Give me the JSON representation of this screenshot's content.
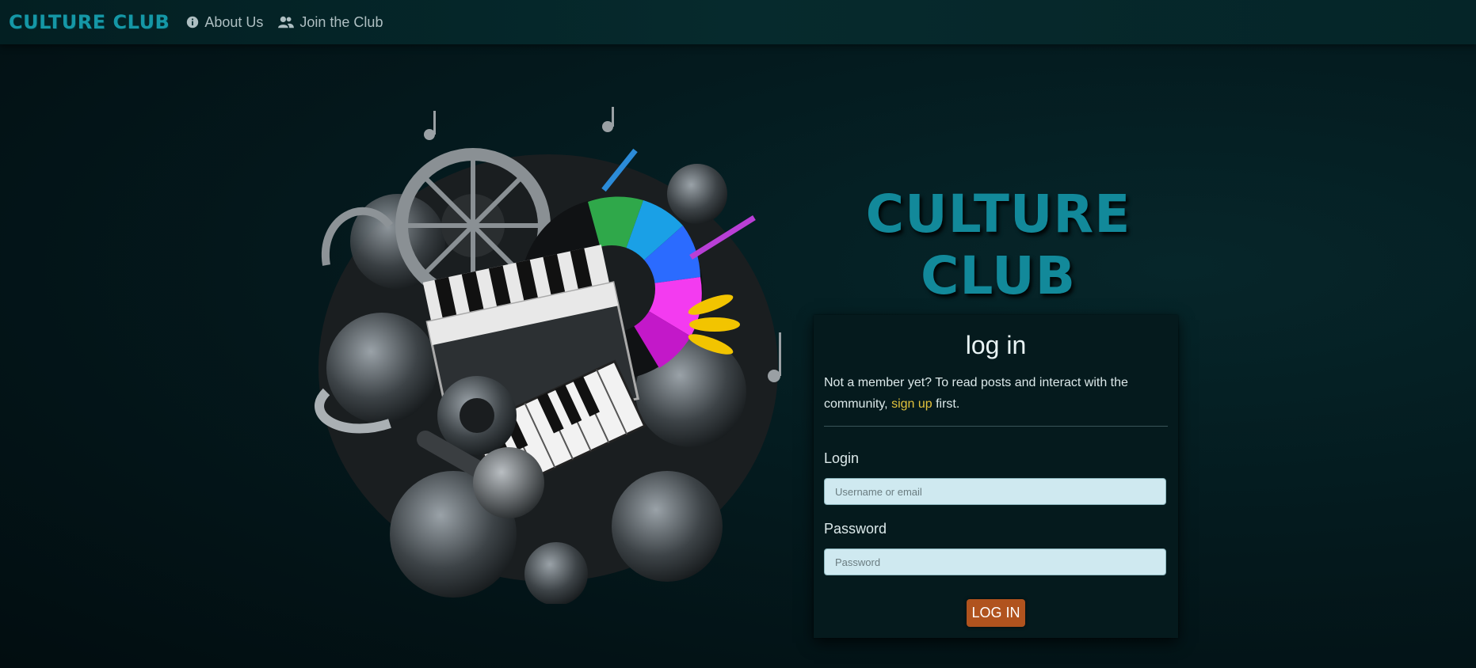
{
  "navbar": {
    "brand": "CULTURE CLUB",
    "links": [
      {
        "label": "About Us",
        "icon": "info-circle-icon"
      },
      {
        "label": "Join the Club",
        "icon": "users-icon"
      }
    ]
  },
  "hero": {
    "image": "culture-collage-illustration"
  },
  "main": {
    "title_line1": "CULTURE",
    "title_line2": "CLUB"
  },
  "login_card": {
    "title": "log in",
    "intro_before": "Not a member yet? To read posts and interact with the community, ",
    "signup_link": "sign up",
    "intro_after": " first.",
    "login_label": "Login",
    "login_placeholder": "Username or email",
    "password_label": "Password",
    "password_placeholder": "Password",
    "submit_label": "LOG IN"
  },
  "colors": {
    "brand": "#1597a6",
    "link_accent": "#e3c23c",
    "button": "#b0531e",
    "input_bg": "#cfe9f0"
  }
}
